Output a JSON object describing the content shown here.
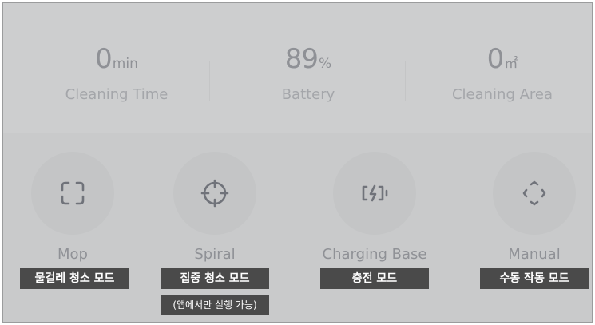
{
  "stats": [
    {
      "value": "0",
      "unit": "min",
      "label": "Cleaning Time"
    },
    {
      "value": "89",
      "unit": "%",
      "label": "Battery"
    },
    {
      "value": "0",
      "unit": "㎡",
      "label": "Cleaning Area"
    }
  ],
  "modes": [
    {
      "name": "Mop",
      "icon": "mop-icon",
      "caption": "물걸레 청소 모드"
    },
    {
      "name": "Spiral",
      "icon": "spiral-icon",
      "caption": "집중 청소 모드",
      "note": "(앱에서만 실행 가능)"
    },
    {
      "name": "Charging Base",
      "icon": "charging-base-icon",
      "caption": "충전 모드"
    },
    {
      "name": "Manual",
      "icon": "manual-icon",
      "caption": "수동 작동 모드"
    }
  ],
  "colors": {
    "background": "#c9cacb",
    "text": "#8f9196",
    "icon": "#70737a",
    "tag": "#4a4a4a"
  }
}
